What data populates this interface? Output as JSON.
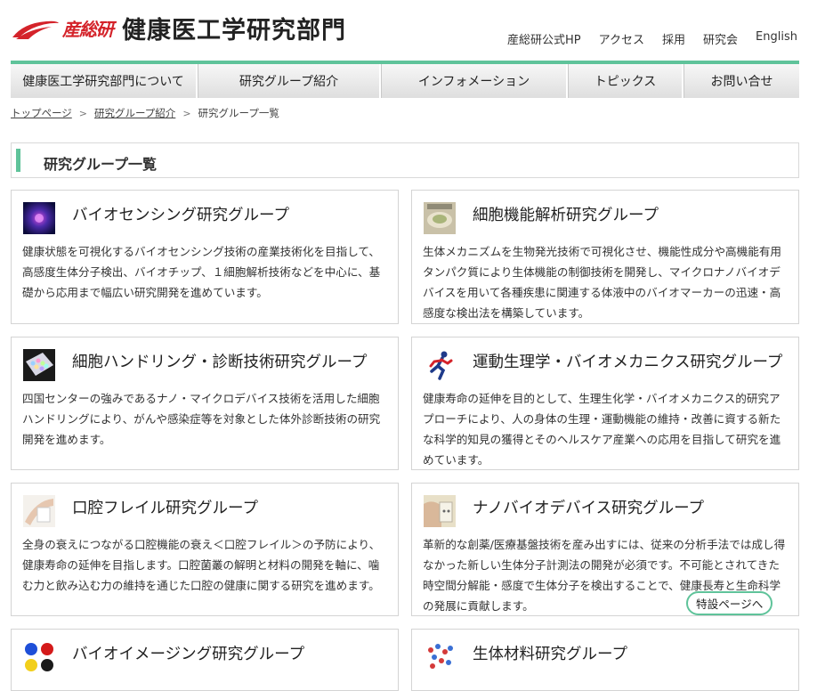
{
  "header": {
    "logo_aist": "産総研",
    "department": "健康医工学研究部門",
    "util_links": [
      "産総研公式HP",
      "アクセス",
      "採用",
      "研究会",
      "English"
    ]
  },
  "nav": [
    "健康医工学研究部門について",
    "研究グループ紹介",
    "インフォメーション",
    "トピックス",
    "お問い合せ"
  ],
  "breadcrumb": {
    "home": "トップページ",
    "parent": "研究グループ紹介",
    "current": "研究グループ一覧",
    "separator": ">"
  },
  "page_title": "研究グループ一覧",
  "colors": {
    "accent": "#5fc39a",
    "brand_red": "#d4232a"
  },
  "groups": [
    {
      "icon": "biosensing-thumbnail-icon",
      "title": "バイオセンシング研究グループ",
      "description": "健康状態を可視化するバイオセンシング技術の産業技術化を目指して、高感度生体分子検出、バイオチップ、１細胞解析技術などを中心に、基礎から応用まで幅広い研究開発を進めています。"
    },
    {
      "icon": "cell-function-thumbnail-icon",
      "title": "細胞機能解析研究グループ",
      "description": "生体メカニズムを生物発光技術で可視化させ、機能性成分や高機能有用タンパク質により生体機能の制御技術を開発し、マイクロナノバイオデバイスを用いて各種疾患に関連する体液中のバイオマーカーの迅速・高感度な検出法を構築しています。"
    },
    {
      "icon": "cell-handling-thumbnail-icon",
      "title": "細胞ハンドリング・診断技術研究グループ",
      "description": "四国センターの強みであるナノ・マイクロデバイス技術を活用した細胞ハンドリングにより、がんや感染症等を対象とした体外診断技術の研究開発を進めます。"
    },
    {
      "icon": "runner-icon",
      "title": "運動生理学・バイオメカニクス研究グループ",
      "description": "健康寿命の延伸を目的として、生理生化学・バイオメカニクス的研究アプローチにより、人の身体の生理・運動機能の維持・改善に資する新たな科学的知見の獲得とそのヘルスケア産業への応用を目指して研究を進めています。"
    },
    {
      "icon": "oral-frail-thumbnail-icon",
      "title": "口腔フレイル研究グループ",
      "description": "全身の衰えにつながる口腔機能の衰え＜口腔フレイル＞の予防により、健康寿命の延伸を目指します。口腔菌叢の解明と材料の開発を軸に、噛む力と飲み込む力の維持を通じた口腔の健康に関する研究を進めます。"
    },
    {
      "icon": "nano-device-thumbnail-icon",
      "title": "ナノバイオデバイス研究グループ",
      "description": "革新的な創薬/医療基盤技術を産み出すには、従来の分析手法では成し得なかった新しい生体分子計測法の開発が必須です。不可能とされてきた時空間分解能・感度で生体分子を検出することで、健康長寿と生命科学の発展に貢献します。",
      "special_link": "特設ページへ"
    },
    {
      "icon": "bioimaging-thumbnail-icon",
      "title": "バイオイメージング研究グループ",
      "description": ""
    },
    {
      "icon": "biomaterial-thumbnail-icon",
      "title": "生体材料研究グループ",
      "description": ""
    }
  ]
}
